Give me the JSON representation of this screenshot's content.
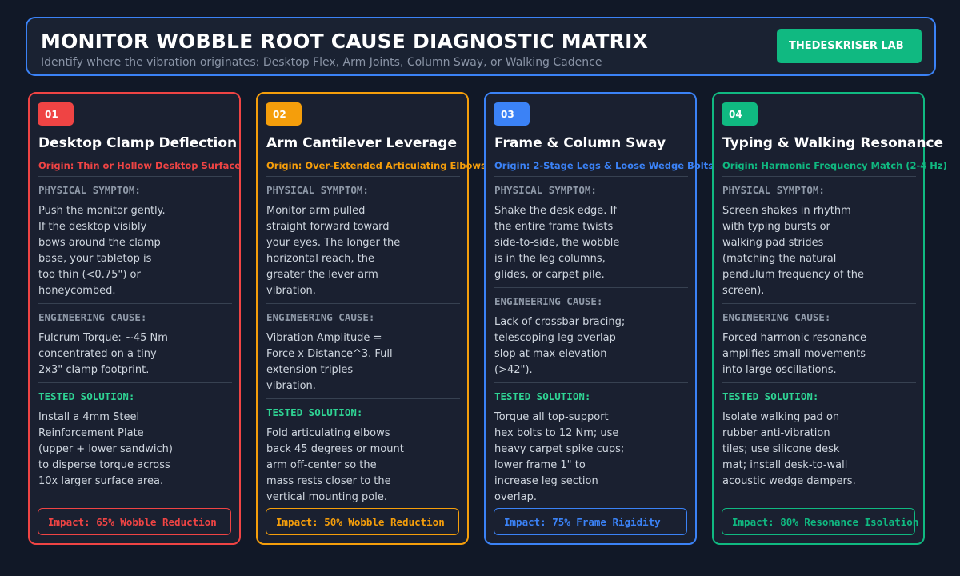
{
  "header": {
    "title": "MONITOR WOBBLE ROOT CAUSE DIAGNOSTIC MATRIX",
    "subtitle": "Identify where the vibration originates: Desktop Flex, Arm Joints, Column Sway, or Walking Cadence",
    "badge": "THEDESKRISER LAB"
  },
  "colors": {
    "red": "#ef4444",
    "orange": "#f59e0b",
    "blue": "#3b82f6",
    "green": "#10b981"
  },
  "labels": {
    "symptom": "PHYSICAL SYMPTOM:",
    "cause": "ENGINEERING CAUSE:",
    "solution": "TESTED SOLUTION:"
  },
  "cards": [
    {
      "num": "01",
      "title": "Desktop Clamp Deflection",
      "origin": "Origin: Thin or Hollow Desktop Surface",
      "symptom": [
        "Push the monitor gently.",
        "If the desktop visibly",
        "bows around the clamp",
        "base, your tabletop is",
        "too thin (<0.75\") or",
        "honeycombed."
      ],
      "cause": [
        "Fulcrum Torque: ~45 Nm",
        "concentrated on a tiny",
        "2x3\" clamp footprint."
      ],
      "solution": [
        "Install a 4mm Steel",
        "Reinforcement Plate",
        "(upper + lower sandwich)",
        "to disperse torque across",
        "10x larger surface area."
      ],
      "impact": "Impact: 65% Wobble Reduction"
    },
    {
      "num": "02",
      "title": "Arm Cantilever Leverage",
      "origin": "Origin: Over-Extended Articulating Elbows",
      "symptom": [
        "Monitor arm pulled",
        "straight forward toward",
        "your eyes. The longer the",
        "horizontal reach, the",
        "greater the lever arm",
        "vibration."
      ],
      "cause": [
        "Vibration Amplitude =",
        "Force x Distance^3. Full",
        "extension triples",
        "vibration."
      ],
      "solution": [
        "Fold articulating elbows",
        "back 45 degrees or mount",
        "arm off-center so the",
        "mass rests closer to the",
        "vertical mounting pole."
      ],
      "impact": "Impact: 50% Wobble Reduction"
    },
    {
      "num": "03",
      "title": "Frame & Column Sway",
      "origin": "Origin: 2-Stage Legs & Loose Wedge Bolts",
      "symptom": [
        "Shake the desk edge. If",
        "the entire frame twists",
        "side-to-side, the wobble",
        "is in the leg columns,",
        "glides, or carpet pile."
      ],
      "cause": [
        "Lack of crossbar bracing;",
        "telescoping leg overlap",
        "slop at max elevation",
        "(>42\")."
      ],
      "solution": [
        "Torque all top-support",
        "hex bolts to 12 Nm; use",
        "heavy carpet spike cups;",
        "lower frame 1\" to",
        "increase leg section",
        "overlap."
      ],
      "impact": "Impact: 75% Frame Rigidity"
    },
    {
      "num": "04",
      "title": "Typing & Walking Resonance",
      "origin": "Origin: Harmonic Frequency Match (2-4 Hz)",
      "symptom": [
        "Screen shakes in rhythm",
        "with typing bursts or",
        "walking pad strides",
        "(matching the natural",
        "pendulum frequency of the",
        "screen)."
      ],
      "cause": [
        "Forced harmonic resonance",
        "amplifies small movements",
        "into large oscillations."
      ],
      "solution": [
        "Isolate walking pad on",
        "rubber anti-vibration",
        "tiles; use silicone desk",
        "mat; install desk-to-wall",
        "acoustic wedge dampers."
      ],
      "impact": "Impact: 80% Resonance Isolation"
    }
  ]
}
